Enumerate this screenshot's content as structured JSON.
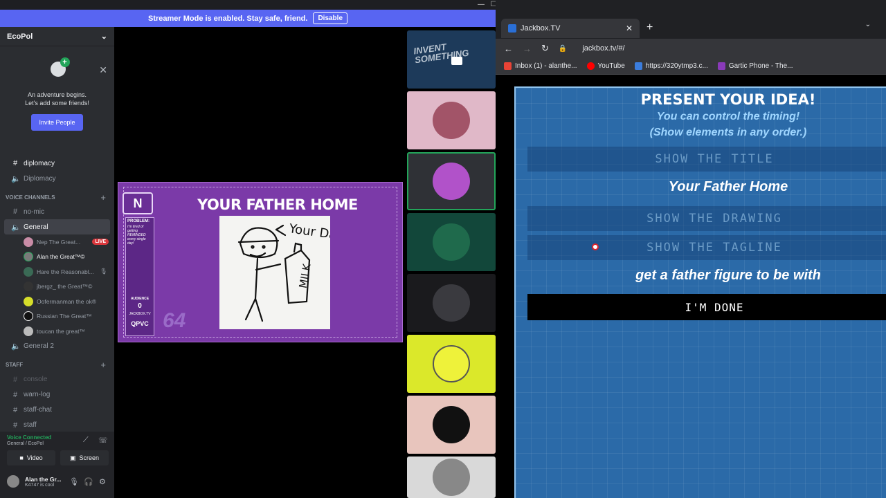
{
  "banner": {
    "text": "Streamer Mode is enabled. Stay safe, friend.",
    "disable_label": "Disable"
  },
  "server": {
    "name": "EcoPol"
  },
  "welcome": {
    "line1": "An adventure begins.",
    "line2": "Let's add some friends!",
    "invite_label": "Invite People"
  },
  "channels_top": [
    {
      "label": "diplomacy",
      "icon": "hash-icon"
    },
    {
      "label": "Diplomacy",
      "icon": "speaker-icon"
    }
  ],
  "voice_category": "VOICE CHANNELS",
  "voice_channels": {
    "nomic": "no-mic",
    "general": "General",
    "general2": "General 2"
  },
  "members": [
    {
      "name": "Nep The Great...",
      "live": "LIVE"
    },
    {
      "name": "Alan the Great™©"
    },
    {
      "name": "Hare the Reasonabl..."
    },
    {
      "name": "jbergz_ the Great™©"
    },
    {
      "name": "Oofermanman the ok®"
    },
    {
      "name": "Russian The Great™"
    },
    {
      "name": "toucan the great™"
    }
  ],
  "staff_category": "STAFF",
  "staff_channels": [
    "console",
    "warn-log",
    "staff-chat",
    "staff"
  ],
  "voice_status": {
    "connected": "Voice Connected",
    "location": "General / EcoPol",
    "video_label": "Video",
    "screen_label": "Screen"
  },
  "user": {
    "name": "Alan the Gr...",
    "status": "K4747 is cool"
  },
  "stream_card": {
    "logo": "N",
    "title": "YOUR FATHER HOME",
    "problem_label": "PROBLEM:",
    "problem_text": "I'm tired of getting REMINDED every single day!",
    "audience_label": "AUDIENCE",
    "audience_count": "0",
    "site": "JACKBOX.TV",
    "room_code": "QPVC",
    "big_number": "64",
    "drawing_text": "Your Dad",
    "drawing_label": "MILK"
  },
  "thumbnail": {
    "line1": "INVENT",
    "line2": "SOMETHING"
  },
  "browser": {
    "tab_title": "Jackbox.TV",
    "url": "jackbox.tv/#/",
    "bookmarks": [
      {
        "label": "Inbox (1) - alanthe...",
        "color": "#ea4335"
      },
      {
        "label": "YouTube",
        "color": "#ff0000"
      },
      {
        "label": "https://320ytmp3.c...",
        "color": "#3b7ddd"
      },
      {
        "label": "Gartic Phone - The...",
        "color": "#8a3ab9"
      }
    ]
  },
  "jackbox": {
    "title": "PRESENT YOUR IDEA!",
    "sub1": "You can control the timing!",
    "sub2": "(Show elements in any order.)",
    "show_title": "SHOW THE TITLE",
    "idea_title": "Your Father Home",
    "show_drawing": "SHOW THE DRAWING",
    "show_tagline": "SHOW THE TAGLINE",
    "tagline": "get a father figure to be with",
    "done": "I'M DONE"
  },
  "colors": {
    "discord_blurple": "#5865f2",
    "discord_green": "#23a55a",
    "live_red": "#da373c",
    "jackbox_blue": "#2b6aa8"
  }
}
